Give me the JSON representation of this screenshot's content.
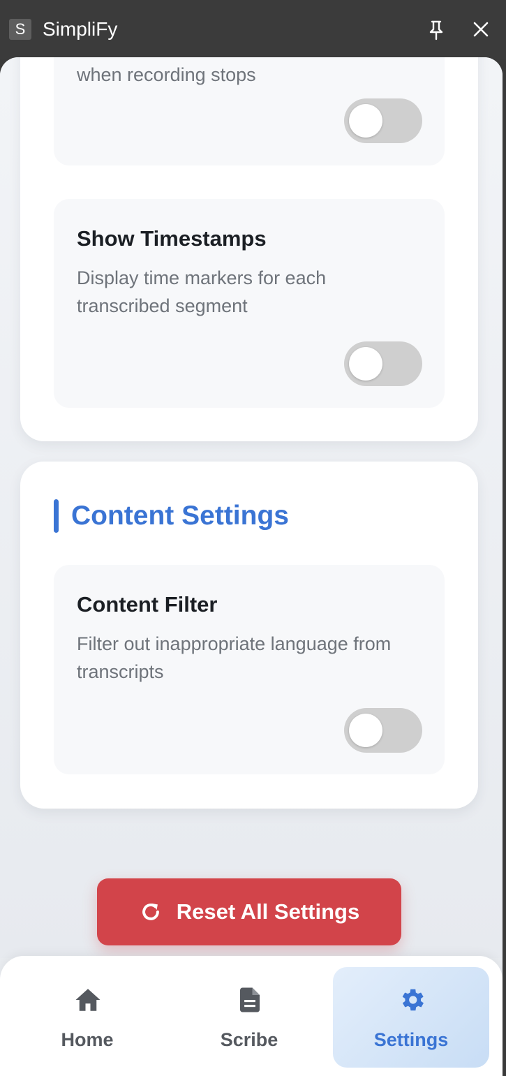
{
  "app": {
    "icon_letter": "S",
    "title": "SimpliFy"
  },
  "settings_sections": {
    "partial_setting": {
      "description": "when recording stops",
      "enabled": false
    },
    "show_timestamps": {
      "title": "Show Timestamps",
      "description": "Display time markers for each transcribed segment",
      "enabled": false
    },
    "content_settings": {
      "heading": "Content Settings",
      "content_filter": {
        "title": "Content Filter",
        "description": "Filter out inappropriate language from transcripts",
        "enabled": false
      }
    }
  },
  "reset_button": {
    "label": "Reset All Settings",
    "icon": "refresh-icon"
  },
  "bottom_nav": {
    "items": [
      {
        "label": "Home",
        "icon": "home-icon",
        "active": false
      },
      {
        "label": "Scribe",
        "icon": "document-icon",
        "active": false
      },
      {
        "label": "Settings",
        "icon": "gear-icon",
        "active": true
      }
    ]
  },
  "colors": {
    "accent": "#3a74d4",
    "danger": "#d2444a",
    "toggle_off": "#cfcfcf",
    "titlebar": "#3b3b3b"
  }
}
